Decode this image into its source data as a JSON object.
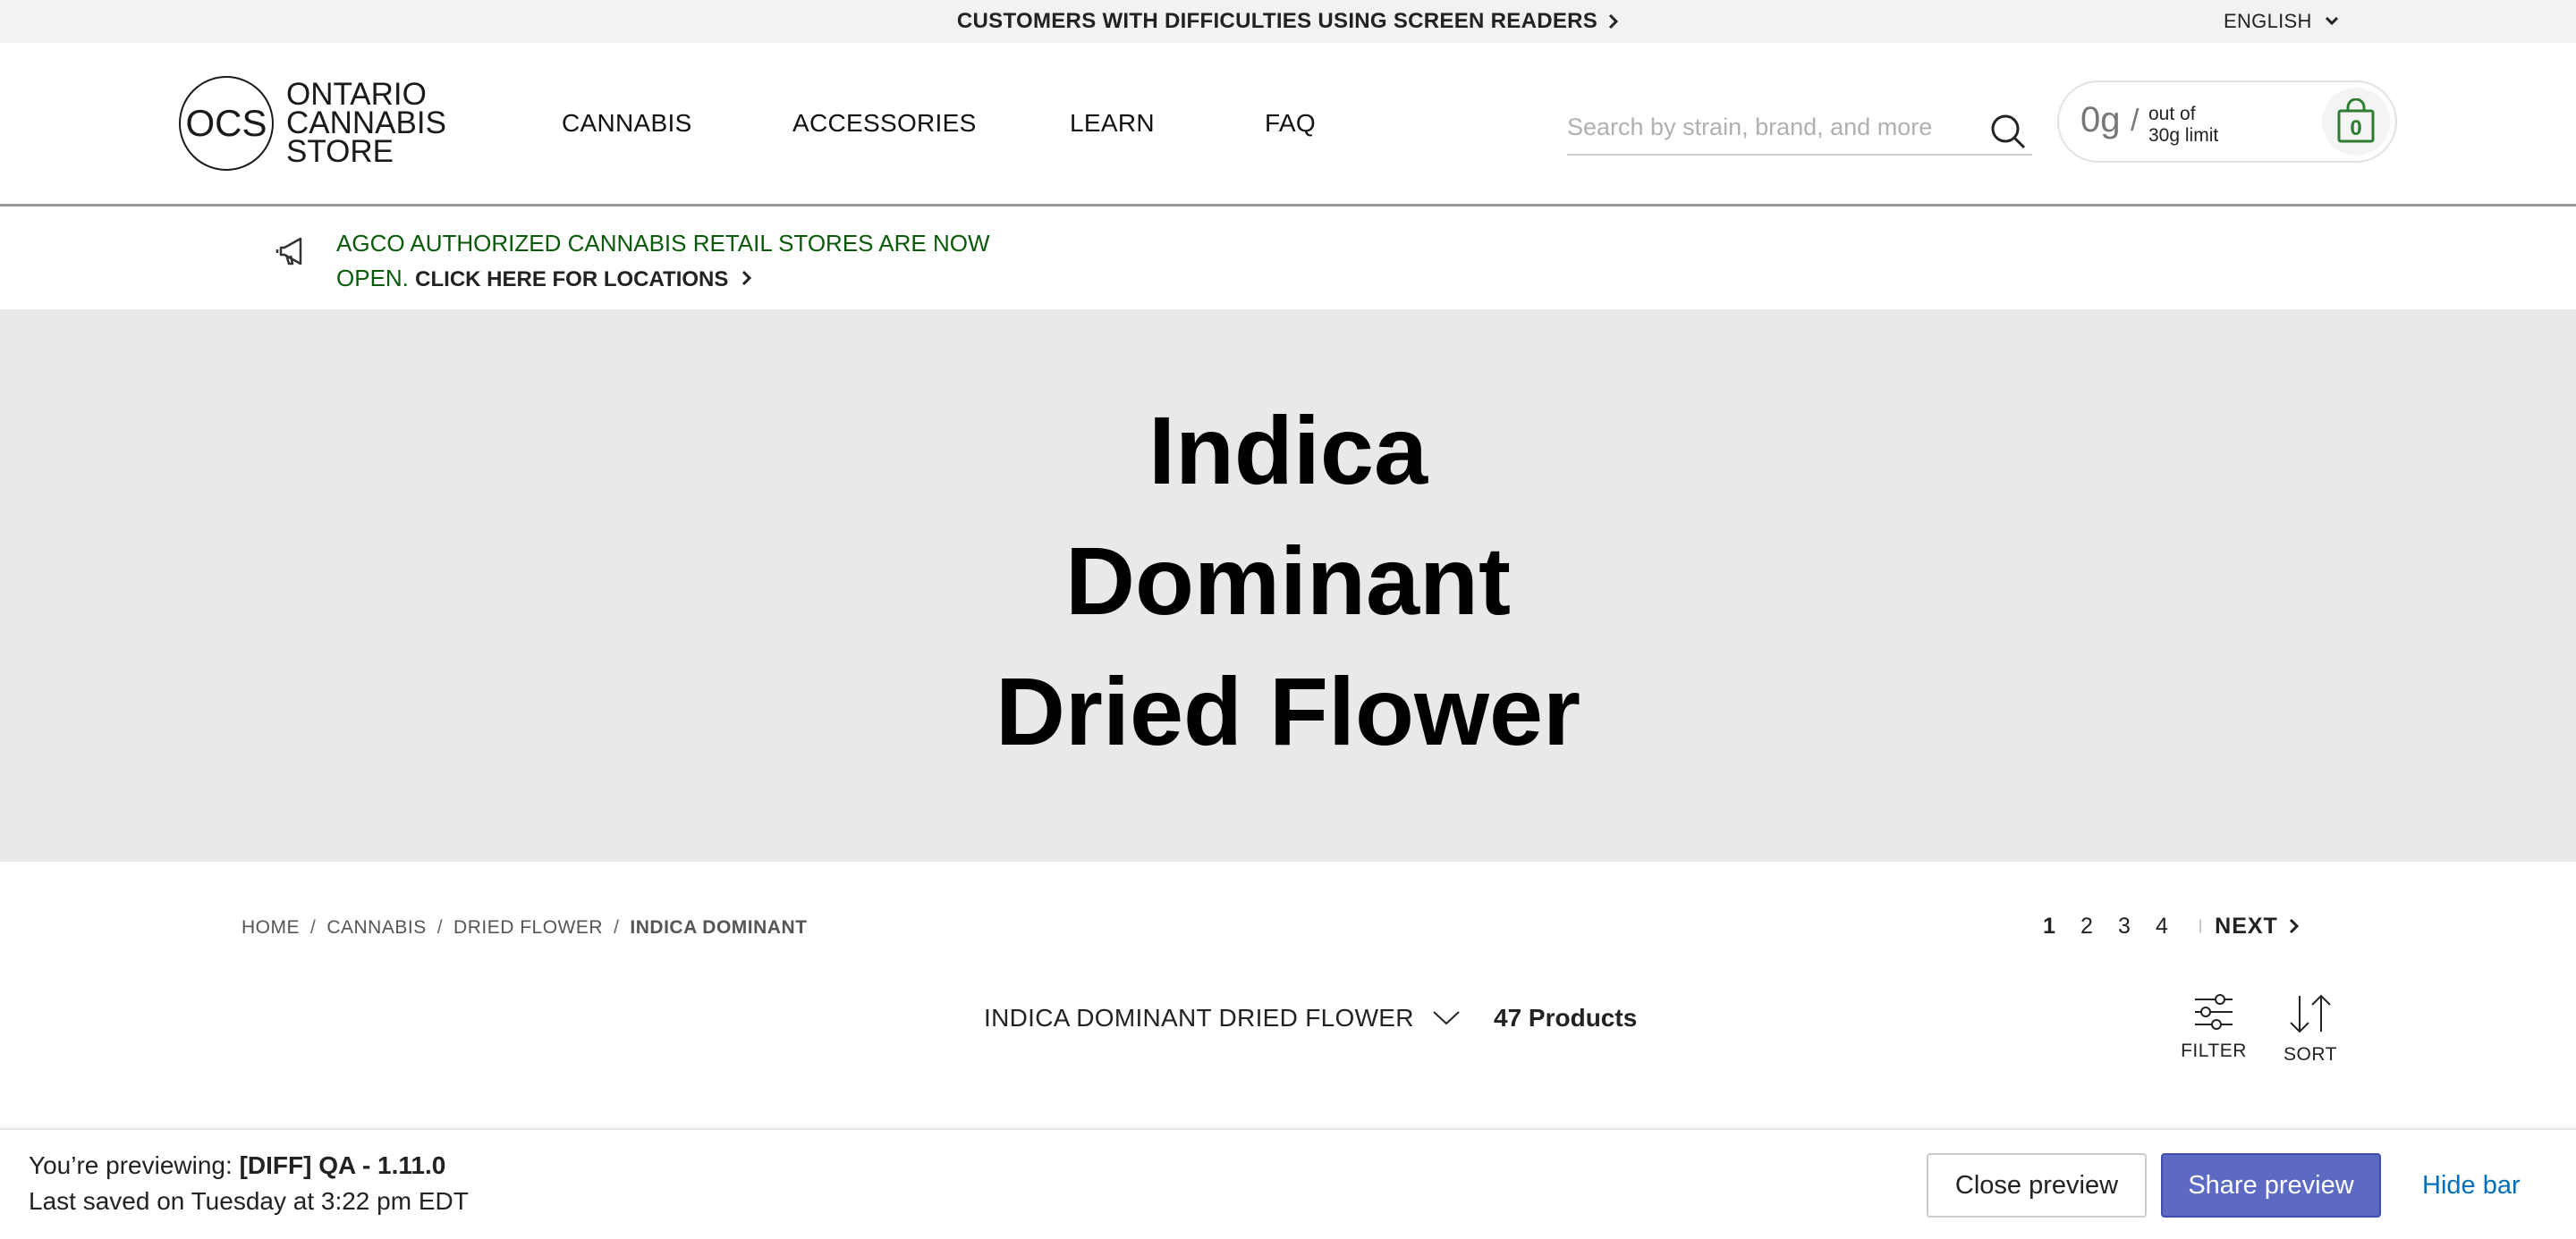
{
  "topbar": {
    "screen_reader_link": "CUSTOMERS WITH DIFFICULTIES USING SCREEN READERS",
    "language": "ENGLISH"
  },
  "header": {
    "logo_mark": "OCS",
    "logo_line1": "ONTARIO",
    "logo_line2": "CANNABIS",
    "logo_line3": "STORE",
    "nav": [
      "CANNABIS",
      "ACCESSORIES",
      "LEARN",
      "FAQ"
    ],
    "search_placeholder": "Search by strain, brand, and more",
    "limit": {
      "grams": "0g",
      "slash": "/",
      "out_of": "out of",
      "limit_text": "30g limit",
      "cart_count": "0"
    }
  },
  "announcement": {
    "text": "AGCO AUTHORIZED CANNABIS RETAIL STORES ARE NOW OPEN.",
    "cta": "CLICK HERE FOR LOCATIONS"
  },
  "hero": {
    "title_line1": "Indica",
    "title_line2": "Dominant",
    "title_line3": "Dried Flower"
  },
  "breadcrumb": [
    "HOME",
    "CANNABIS",
    "DRIED FLOWER",
    "INDICA DOMINANT"
  ],
  "pagination": {
    "pages": [
      "1",
      "2",
      "3",
      "4"
    ],
    "current": "1",
    "next": "NEXT"
  },
  "listing": {
    "category": "INDICA DOMINANT DRIED FLOWER",
    "count": "47 Products",
    "filter_label": "FILTER",
    "sort_label": "SORT"
  },
  "preview_bar": {
    "prefix": "You’re previewing:",
    "theme": "[DIFF] QA - 1.11.0",
    "saved": "Last saved on Tuesday at 3:22 pm EDT",
    "close_label": "Close preview",
    "share_label": "Share preview",
    "hide_label": "Hide bar"
  },
  "colors": {
    "announcement_green": "#0a5a0a",
    "hero_bg": "#e9e9e9",
    "share_button": "#5c6ac4",
    "hide_link": "#006fbb",
    "cart_green": "#2e7d32"
  }
}
